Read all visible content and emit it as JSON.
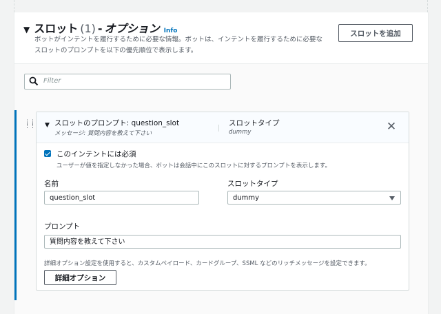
{
  "section": {
    "caret": "▼",
    "title": "スロット",
    "count": "(1)",
    "separator": "-",
    "options": "オプション",
    "info_link": "Info",
    "description": "ボットがインテントを履行するために必要な情報。ボットは、インテントを履行するために必要なスロットのプロンプトを以下の優先順位で表示します。",
    "add_button": "スロットを追加"
  },
  "filter": {
    "placeholder": "Filter"
  },
  "slot": {
    "header_prompt": "スロットのプロンプト: question_slot",
    "header_message": "メッセージ: 質問内容を教えて下さい",
    "header_type_label": "スロットタイプ",
    "header_type_value": "dummy",
    "close_glyph": "✕",
    "required_label": "このインテントには必須",
    "required_checked": true,
    "required_desc": "ユーザーが値を指定しなかった場合、ボットは会話中にこのスロットに対するプロンプトを表示します。",
    "name_label": "名前",
    "name_value": "question_slot",
    "type_label": "スロットタイプ",
    "type_value": "dummy",
    "prompt_label": "プロンプト",
    "prompt_value": "質問内容を教えて下さい",
    "advanced_desc": "詳細オプション設定を使用すると、カスタムペイロード、カードグループ、SSML などのリッチメッセージを設定できます。",
    "advanced_button": "詳細オプション"
  },
  "icons": [
    "caret-down-icon",
    "info-link",
    "search-icon",
    "drag-handle-icon",
    "close-icon",
    "checkbox-checked-icon",
    "dropdown-arrow-icon"
  ],
  "colors": {
    "accent": "#0073bb",
    "border": "#aab7b8",
    "muted_text": "#545b64"
  }
}
